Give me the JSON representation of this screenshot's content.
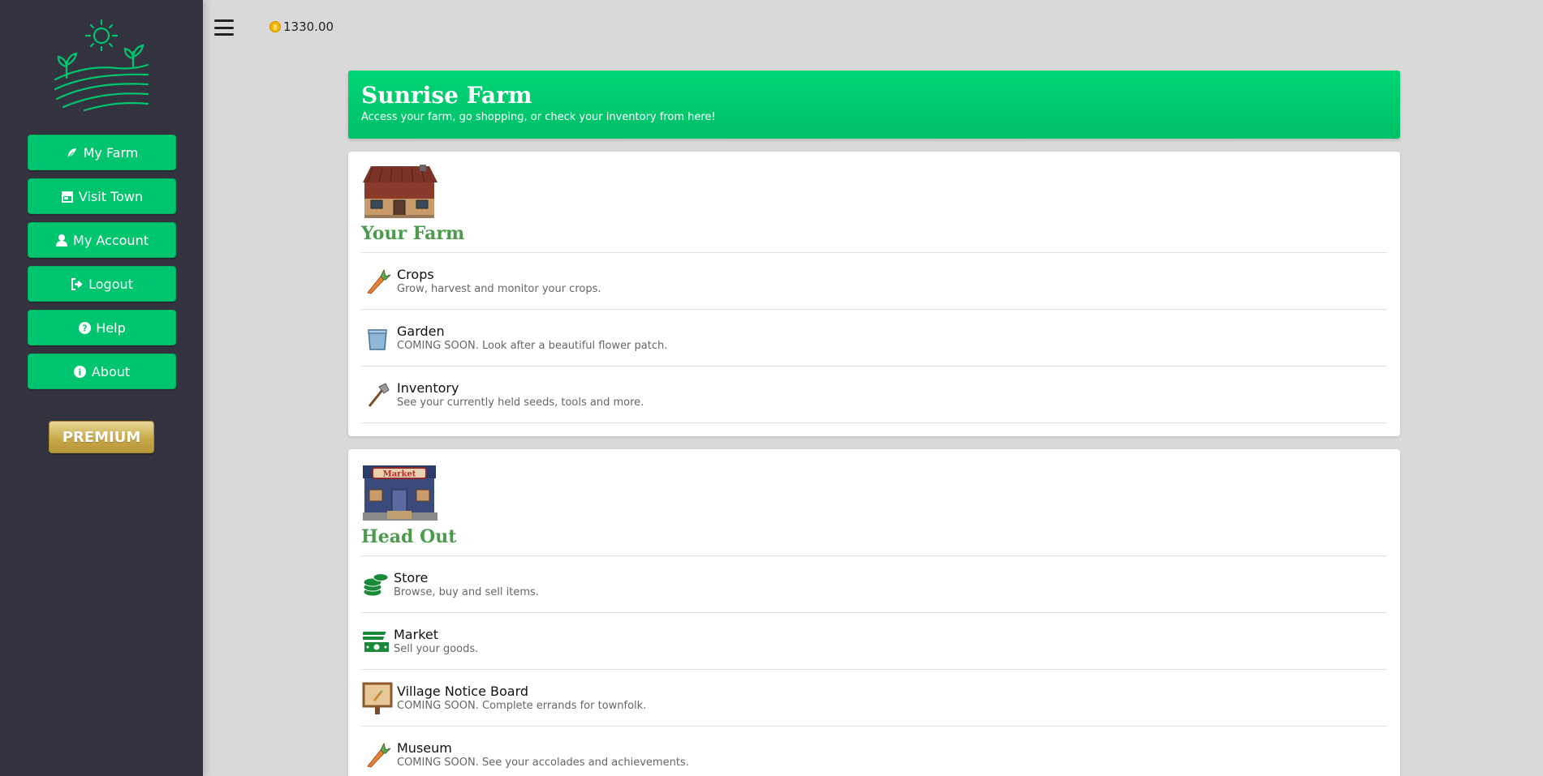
{
  "sidebar": {
    "nav": [
      {
        "label": "My Farm",
        "icon": "feather-icon"
      },
      {
        "label": "Visit Town",
        "icon": "shop-icon"
      },
      {
        "label": "My Account",
        "icon": "user-icon"
      },
      {
        "label": "Logout",
        "icon": "logout-icon"
      },
      {
        "label": "Help",
        "icon": "question-icon"
      },
      {
        "label": "About",
        "icon": "info-icon"
      }
    ],
    "premium_label": "PREMIUM"
  },
  "topbar": {
    "coins": "1330.00"
  },
  "header": {
    "title": "Sunrise Farm",
    "subtitle": "Access your farm, go shopping, or check your inventory from here!"
  },
  "farm_section": {
    "title": "Your Farm",
    "items": [
      {
        "title": "Crops",
        "desc": "Grow, harvest and monitor your crops.",
        "icon": "carrot-icon"
      },
      {
        "title": "Garden",
        "desc": "COMING SOON. Look after a beautiful flower patch.",
        "icon": "pot-icon"
      },
      {
        "title": "Inventory",
        "desc": "See your currently held seeds, tools and more.",
        "icon": "shovel-icon"
      }
    ]
  },
  "town_section": {
    "title": "Head Out",
    "items": [
      {
        "title": "Store",
        "desc": "Browse, buy and sell items.",
        "icon": "coins-stack-icon"
      },
      {
        "title": "Market",
        "desc": "Sell your goods.",
        "icon": "money-icon"
      },
      {
        "title": "Village Notice Board",
        "desc": "COMING SOON. Complete errands for townfolk.",
        "icon": "notice-board-icon"
      },
      {
        "title": "Museum",
        "desc": "COMING SOON. See your accolades and achievements.",
        "icon": "carrot-icon"
      }
    ],
    "market_sign": "Market"
  },
  "colors": {
    "accent": "#00c46e",
    "sidebar_bg": "#33333f",
    "section_title": "#4c9a4c"
  }
}
